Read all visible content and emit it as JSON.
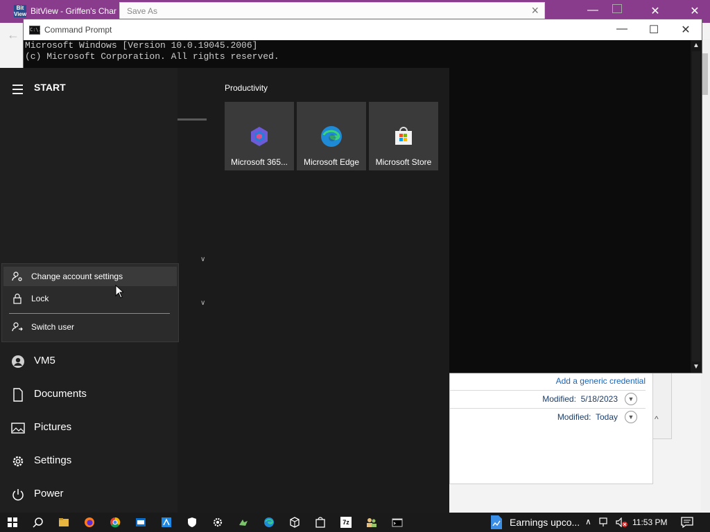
{
  "background_window": {
    "tab_title": "BitView - Griffen's Char",
    "logo_text": "Bit View",
    "back_icon": "back-arrow-icon",
    "controls": [
      "minimize-icon",
      "maximize-icon",
      "close-icon"
    ]
  },
  "save_as": {
    "title": "Save As",
    "close_glyph": "×"
  },
  "credentials": {
    "add_link": "Add a generic credential",
    "rows": [
      {
        "label": "Modified:",
        "value": "5/18/2023"
      },
      {
        "label": "Modified:",
        "value": "Today"
      }
    ]
  },
  "command_prompt": {
    "title": "Command Prompt",
    "icon_text": "C:\\.",
    "lines": [
      "Microsoft Windows [Version 10.0.19045.2006]",
      "(c) Microsoft Corporation. All rights reserved."
    ],
    "controls": {
      "minimize": "—",
      "maximize": "☐",
      "close": "✕"
    }
  },
  "start_menu": {
    "title": "START",
    "account_menu": {
      "items": [
        {
          "label": "Change account settings",
          "icon": "person-gear-icon",
          "highlighted": true
        },
        {
          "label": "Lock",
          "icon": "lock-icon"
        },
        {
          "label": "Switch user",
          "icon": "switch-user-icon"
        }
      ]
    },
    "sidebar": [
      {
        "label": "VM5",
        "icon": "avatar-icon"
      },
      {
        "label": "Documents",
        "icon": "document-icon"
      },
      {
        "label": "Pictures",
        "icon": "pictures-icon"
      },
      {
        "label": "Settings",
        "icon": "gear-icon"
      },
      {
        "label": "Power",
        "icon": "power-icon"
      }
    ],
    "tile_group": "Productivity",
    "tiles": [
      {
        "label": "Microsoft 365...",
        "icon": "microsoft-365-icon"
      },
      {
        "label": "Microsoft Edge",
        "icon": "edge-icon"
      },
      {
        "label": "Microsoft Store",
        "icon": "store-icon"
      }
    ]
  },
  "taskbar": {
    "apps": [
      "start-icon",
      "search-icon",
      "file-explorer-icon",
      "firefox-icon",
      "chrome-icon",
      "outlook-icon",
      "azure-icon",
      "defender-icon",
      "settings-icon",
      "game-icon",
      "edge-icon",
      "box-icon",
      "store-icon",
      "7zip-icon",
      "people-icon",
      "cmd-icon"
    ],
    "seven_zip_text": "7z",
    "notice": "Earnings upco...",
    "clock": "11:53 PM"
  },
  "colors": {
    "title_bar": "#8a3c8c",
    "start_bg": "#1f1f1f",
    "tile_bg": "#3a3a3a",
    "link": "#1e64b4"
  }
}
